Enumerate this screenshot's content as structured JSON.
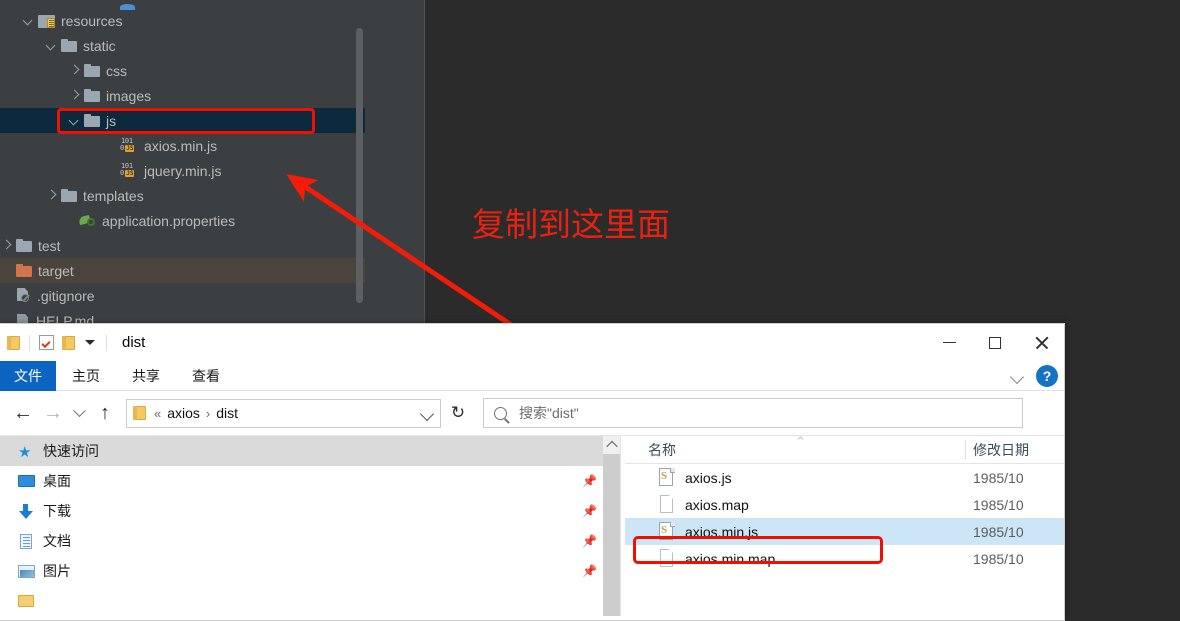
{
  "ide": {
    "tree": [
      {
        "label": "resources",
        "icon": "resources-folder-icon",
        "chevron": "open",
        "indent": 22,
        "state": "normal"
      },
      {
        "label": "static",
        "icon": "folder-icon",
        "chevron": "open",
        "indent": 45,
        "state": "normal"
      },
      {
        "label": "css",
        "icon": "folder-icon",
        "chevron": "closed",
        "indent": 68,
        "state": "normal"
      },
      {
        "label": "images",
        "icon": "folder-icon",
        "chevron": "closed",
        "indent": 68,
        "state": "normal"
      },
      {
        "label": "js",
        "icon": "folder-icon",
        "chevron": "open",
        "indent": 68,
        "state": "selected"
      },
      {
        "label": "axios.min.js",
        "icon": "js-file-icon",
        "chevron": "none",
        "indent": 104,
        "state": "normal"
      },
      {
        "label": "jquery.min.js",
        "icon": "js-file-icon",
        "chevron": "none",
        "indent": 104,
        "state": "normal"
      },
      {
        "label": "templates",
        "icon": "folder-icon",
        "chevron": "closed",
        "indent": 45,
        "state": "normal"
      },
      {
        "label": "application.properties",
        "icon": "properties-icon",
        "chevron": "none",
        "indent": 63,
        "state": "normal"
      },
      {
        "label": "test",
        "icon": "folder-icon",
        "chevron": "closed",
        "indent": 0,
        "state": "normal"
      },
      {
        "label": "target",
        "icon": "folder-orange-icon",
        "chevron": "none",
        "indent": 0,
        "state": "highlighted"
      },
      {
        "label": ".gitignore",
        "icon": "gitignore-icon",
        "chevron": "none",
        "indent": 0,
        "state": "normal"
      },
      {
        "label": "HELP.md",
        "icon": "markdown-icon",
        "chevron": "none",
        "indent": 0,
        "state": "normal"
      }
    ],
    "annotation": {
      "text": "复制到这里面",
      "color": "#e8220f"
    },
    "colors": {
      "tree_background": "#3c3f41",
      "editor_background": "#2b2b2b",
      "selection": "#0d293e",
      "highlight": "#4a443c",
      "text": "#bbbbbb",
      "annotation_red": "#f01000"
    }
  },
  "explorer": {
    "titlebar": {
      "title": "dist",
      "quick_access": [
        "folder-icon",
        "properties-checkbox-icon",
        "folder-icon",
        "customize-caret-icon"
      ],
      "window_controls": [
        "minimize-icon",
        "maximize-icon",
        "close-icon"
      ]
    },
    "ribbon": {
      "tabs": [
        {
          "label": "文件",
          "active": true
        },
        {
          "label": "主页",
          "active": false
        },
        {
          "label": "共享",
          "active": false
        },
        {
          "label": "查看",
          "active": false
        }
      ],
      "collapse_icon": "chevron-down-icon",
      "help_label": "?"
    },
    "address": {
      "back_icon": "←",
      "forward_icon": "→",
      "recent_icon": "chevron-down-icon",
      "up_icon": "↑",
      "breadcrumb_prefix": "«",
      "breadcrumb": [
        "axios",
        "dist"
      ],
      "breadcrumb_separator": "›",
      "refresh_icon": "↻",
      "search_placeholder": "搜索\"dist\""
    },
    "navpane": {
      "items": [
        {
          "label": "快速访问",
          "icon": "star-icon",
          "selected": true,
          "pinned": false
        },
        {
          "label": "桌面",
          "icon": "desktop-icon",
          "selected": false,
          "pinned": true
        },
        {
          "label": "下载",
          "icon": "download-icon",
          "selected": false,
          "pinned": true
        },
        {
          "label": "文档",
          "icon": "documents-icon",
          "selected": false,
          "pinned": true
        },
        {
          "label": "图片",
          "icon": "pictures-icon",
          "selected": false,
          "pinned": true
        }
      ],
      "pin_glyph": "📌"
    },
    "filelist": {
      "columns": [
        {
          "label": "名称",
          "sorted": "asc"
        },
        {
          "label": "修改日期",
          "sorted": "none"
        }
      ],
      "sort_caret": "⌃",
      "rows": [
        {
          "name": "axios.js",
          "icon": "js-file-icon",
          "date": "1985/10",
          "selected": false
        },
        {
          "name": "axios.map",
          "icon": "blank-file-icon",
          "date": "1985/10",
          "selected": false
        },
        {
          "name": "axios.min.js",
          "icon": "js-file-icon",
          "date": "1985/10",
          "selected": true
        },
        {
          "name": "axios.min.map",
          "icon": "blank-file-icon",
          "date": "1985/10",
          "selected": false
        }
      ]
    }
  }
}
